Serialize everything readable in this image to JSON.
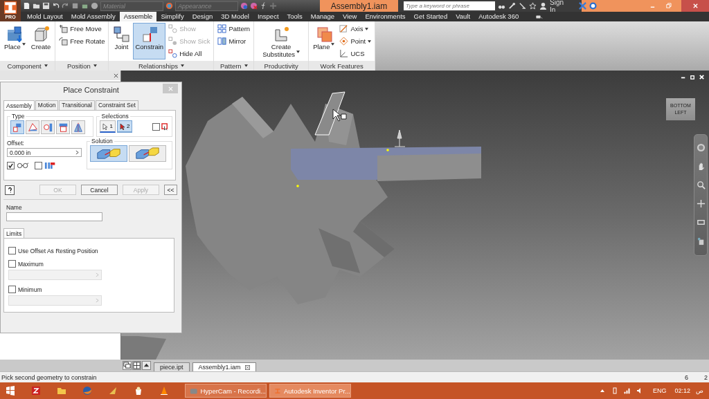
{
  "title_bar": {
    "app_badge": "PRO",
    "material_placeholder": "Material",
    "appearance_placeholder": "Appearance",
    "title": "Assembly1.iam",
    "search": {
      "placeholder": "Type a keyword or phrase"
    },
    "sign_in": "Sign In"
  },
  "ribbon_tabs": [
    {
      "label": "Mold Layout",
      "selected": false
    },
    {
      "label": "Mold Assembly",
      "selected": false
    },
    {
      "label": "Assemble",
      "selected": true
    },
    {
      "label": "Simplify",
      "selected": false
    },
    {
      "label": "Design",
      "selected": false
    },
    {
      "label": "3D Model",
      "selected": false
    },
    {
      "label": "Inspect",
      "selected": false
    },
    {
      "label": "Tools",
      "selected": false
    },
    {
      "label": "Manage",
      "selected": false
    },
    {
      "label": "View",
      "selected": false
    },
    {
      "label": "Environments",
      "selected": false
    },
    {
      "label": "Get Started",
      "selected": false
    },
    {
      "label": "Vault",
      "selected": false
    },
    {
      "label": "Autodesk 360",
      "selected": false
    }
  ],
  "ribbon_panels": [
    {
      "title": "Component",
      "tools": [
        {
          "label": "Place",
          "kind": "large",
          "dropdown": true,
          "active": false,
          "disabled": false
        },
        {
          "label": "Create",
          "kind": "large",
          "dropdown": false,
          "active": false,
          "disabled": false
        }
      ]
    },
    {
      "title": "Position",
      "tools": [
        {
          "label": "Free Move",
          "kind": "small",
          "dropdown": false,
          "active": false,
          "disabled": false
        },
        {
          "label": "Free Rotate",
          "kind": "small",
          "dropdown": false,
          "active": false,
          "disabled": false
        }
      ]
    },
    {
      "title": "Relationships",
      "tools": [
        {
          "label": "Joint",
          "kind": "large",
          "dropdown": false,
          "active": false,
          "disabled": false
        },
        {
          "label": "Constrain",
          "kind": "large",
          "dropdown": false,
          "active": true,
          "disabled": false
        },
        {
          "label": "Show",
          "kind": "small",
          "dropdown": false,
          "active": false,
          "disabled": true
        },
        {
          "label": "Show Sick",
          "kind": "small",
          "dropdown": false,
          "active": false,
          "disabled": true
        },
        {
          "label": "Hide All",
          "kind": "small",
          "dropdown": false,
          "active": false,
          "disabled": false
        }
      ]
    },
    {
      "title": "Pattern",
      "tools": [
        {
          "label": "Pattern",
          "kind": "small",
          "dropdown": false,
          "active": false,
          "disabled": false
        },
        {
          "label": "Mirror",
          "kind": "small",
          "dropdown": false,
          "active": false,
          "disabled": false
        }
      ]
    },
    {
      "title": "Productivity",
      "tools": [
        {
          "label": "Create Substitutes",
          "kind": "large",
          "dropdown": true,
          "active": false,
          "disabled": false
        }
      ]
    },
    {
      "title": "Work Features",
      "tools": [
        {
          "label": "Plane",
          "kind": "large",
          "dropdown": true,
          "active": false,
          "disabled": false
        },
        {
          "label": "Axis",
          "kind": "small",
          "dropdown": true,
          "active": false,
          "disabled": false
        },
        {
          "label": "Point",
          "kind": "small",
          "dropdown": true,
          "active": false,
          "disabled": false
        },
        {
          "label": "UCS",
          "kind": "small",
          "dropdown": false,
          "active": false,
          "disabled": false
        }
      ]
    }
  ],
  "dialog": {
    "title": "Place Constraint",
    "tabs": [
      {
        "label": "Assembly",
        "selected": true
      },
      {
        "label": "Motion",
        "selected": false
      },
      {
        "label": "Transitional",
        "selected": false
      },
      {
        "label": "Constraint Set",
        "selected": false
      }
    ],
    "type_group": {
      "title": "Type",
      "options": [
        {
          "selected": true
        },
        {
          "selected": false
        },
        {
          "selected": false
        },
        {
          "selected": false
        },
        {
          "selected": false
        }
      ]
    },
    "selections_group": {
      "title": "Selections",
      "picks": [
        {
          "label": "1",
          "selected": false
        },
        {
          "label": "2",
          "selected": true
        }
      ],
      "pick_one_part": {
        "checked": false
      }
    },
    "offset": {
      "label": "Offset:",
      "value": "0.000 in"
    },
    "options": [
      {
        "checked": true
      },
      {
        "checked": false
      }
    ],
    "solution_group": {
      "title": "Solution",
      "options": [
        {
          "selected": true
        },
        {
          "selected": false
        }
      ]
    },
    "buttons": [
      {
        "label": "OK",
        "disabled": true
      },
      {
        "label": "Cancel",
        "disabled": false
      },
      {
        "label": "Apply",
        "disabled": true
      }
    ],
    "collapse_button": "<<",
    "name": {
      "label": "Name"
    },
    "limits": {
      "tab": "Limits",
      "resting": {
        "label": "Use Offset As Resting Position",
        "checked": false
      },
      "ranges": [
        {
          "label": "Maximum",
          "checked": false
        },
        {
          "label": "Minimum",
          "checked": false
        }
      ]
    }
  },
  "viewport": {
    "view_cube": {
      "face": "BOTTOM",
      "side": "LEFT"
    }
  },
  "document_tabs": [
    {
      "label": "piece.ipt",
      "selected": false
    },
    {
      "label": "Assembly1.iam",
      "selected": true
    }
  ],
  "status_bar": {
    "message": "Pick second geometry to constrain",
    "fields": [
      "6",
      "2"
    ]
  },
  "taskbar": {
    "windows": [
      {
        "label": "HyperCam - Recordi...",
        "selected": false
      },
      {
        "label": "Autodesk Inventor Pr...",
        "selected": true
      }
    ],
    "language": "ENG",
    "time": "02:12",
    "period": "ص"
  }
}
